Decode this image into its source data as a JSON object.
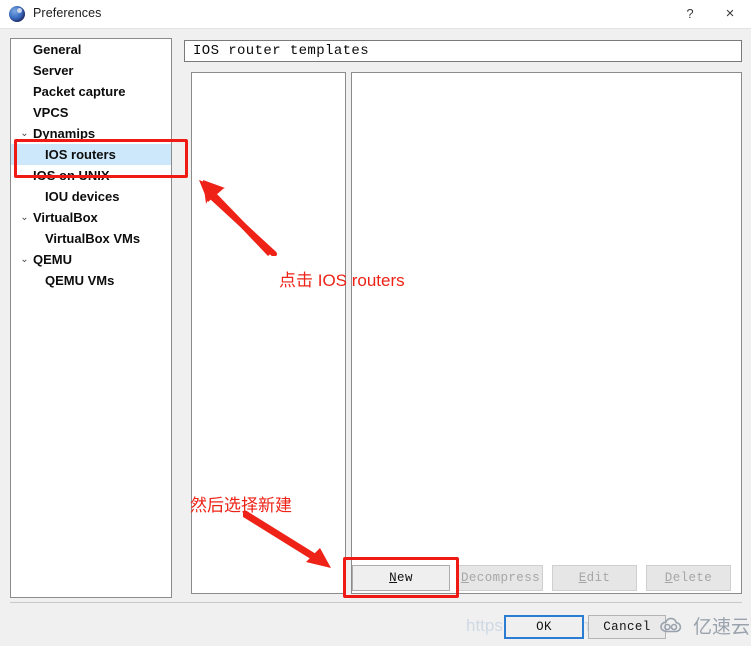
{
  "window": {
    "title": "Preferences",
    "icon": "gns3-globe-icon",
    "help_label": "?",
    "close_label": "×"
  },
  "sidebar": {
    "items": [
      {
        "label": "General",
        "level": 0,
        "chevron": "",
        "selected": false
      },
      {
        "label": "Server",
        "level": 0,
        "chevron": "",
        "selected": false
      },
      {
        "label": "Packet capture",
        "level": 0,
        "chevron": "",
        "selected": false
      },
      {
        "label": "VPCS",
        "level": 0,
        "chevron": "",
        "selected": false
      },
      {
        "label": "Dynamips",
        "level": 0,
        "chevron": "⌄",
        "selected": false
      },
      {
        "label": "IOS routers",
        "level": 1,
        "chevron": "",
        "selected": true
      },
      {
        "label": "IOS on UNIX",
        "level": 0,
        "chevron": "⌄",
        "selected": false
      },
      {
        "label": "IOU devices",
        "level": 1,
        "chevron": "",
        "selected": false
      },
      {
        "label": "VirtualBox",
        "level": 0,
        "chevron": "⌄",
        "selected": false
      },
      {
        "label": "VirtualBox VMs",
        "level": 1,
        "chevron": "",
        "selected": false
      },
      {
        "label": "QEMU",
        "level": 0,
        "chevron": "⌄",
        "selected": false
      },
      {
        "label": "QEMU VMs",
        "level": 1,
        "chevron": "",
        "selected": false
      }
    ]
  },
  "main": {
    "group_title": "IOS router templates",
    "left_list_items": [],
    "right_list_items": [],
    "buttons": {
      "new": {
        "label": "New",
        "mnemonic": "N",
        "enabled": true
      },
      "decompress": {
        "label": "Decompress",
        "mnemonic": "D",
        "enabled": false
      },
      "edit": {
        "label": "Edit",
        "mnemonic": "E",
        "enabled": false
      },
      "delete": {
        "label": "Delete",
        "mnemonic": "D",
        "enabled": false
      }
    }
  },
  "footer": {
    "ok_label": "OK",
    "cancel_label": "Cancel"
  },
  "annotations": {
    "note_1": "点击 IOS routers",
    "note_2": "然后选择新建",
    "highlight_color": "#ef1a14"
  },
  "watermark": {
    "url_text": "https://blog.csdn.net",
    "logo_text": "亿速云"
  }
}
